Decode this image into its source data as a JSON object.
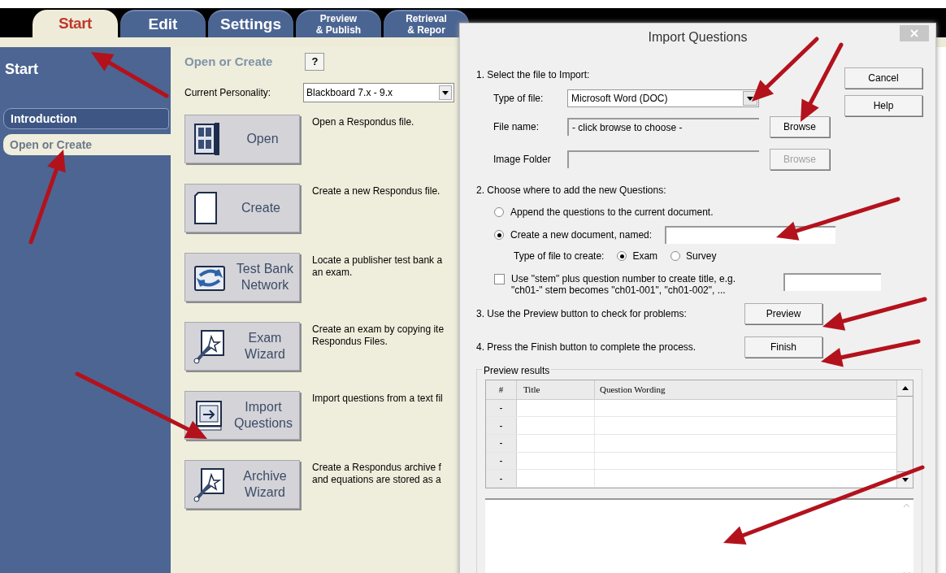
{
  "tabs": [
    {
      "lines": [
        "Start"
      ],
      "selected": true
    },
    {
      "lines": [
        "Edit"
      ],
      "selected": false
    },
    {
      "lines": [
        "Settings"
      ],
      "selected": false
    },
    {
      "lines": [
        "Preview",
        "& Publish"
      ],
      "selected": false
    },
    {
      "lines": [
        "Retrieval",
        "& Repor"
      ],
      "selected": false
    }
  ],
  "sidebar": {
    "title": "Start",
    "items": [
      {
        "label": "Introduction",
        "selected": false
      },
      {
        "label": "Open or Create",
        "selected": true
      }
    ]
  },
  "main": {
    "heading": "Open or Create",
    "help": "?",
    "personality_label": "Current Personality:",
    "personality_value": "Blackboard 7.x - 9.x",
    "actions": [
      {
        "kind": "open",
        "lines": [
          "Open"
        ],
        "description": [
          "Open a Respondus file."
        ]
      },
      {
        "kind": "create",
        "lines": [
          "Create"
        ],
        "description": [
          "Create a new Respondus file."
        ]
      },
      {
        "kind": "network",
        "lines": [
          "Test Bank",
          "Network"
        ],
        "description": [
          "Locate a publisher test bank a",
          "an exam."
        ]
      },
      {
        "kind": "wizard",
        "lines": [
          "Exam",
          "Wizard"
        ],
        "description": [
          "Create an exam by copying ite",
          "Respondus Files."
        ]
      },
      {
        "kind": "import",
        "lines": [
          "Import",
          "Questions"
        ],
        "description": [
          "Import questions from a text fil"
        ]
      },
      {
        "kind": "wizard",
        "lines": [
          "Archive",
          "Wizard"
        ],
        "description": [
          "Create a Respondus archive f",
          "and equations are stored as a"
        ]
      }
    ]
  },
  "dialog": {
    "title": "Import Questions",
    "cancel": "Cancel",
    "help": "Help",
    "step1": "1.  Select the file to Import:",
    "type_label": "Type of file:",
    "type_value": "Microsoft Word (DOC)",
    "file_label": "File name:",
    "file_value": "- click browse to choose -",
    "browse": "Browse",
    "folder_label": "Image Folder",
    "folder_browse": "Browse",
    "folder_browse_disabled": true,
    "step2": "2.  Choose where to add the new Questions:",
    "targets": [
      {
        "label": "Append the questions to the current document.",
        "selected": false
      },
      {
        "label": "Create a new document, named:",
        "selected": true
      }
    ],
    "filetype_label": "Type of file to create:",
    "filetypes": [
      {
        "label": "Exam",
        "selected": true
      },
      {
        "label": "Survey",
        "selected": false
      }
    ],
    "stem_checked": false,
    "stem_lines": [
      "Use \"stem\" plus question number to create title,  e.g.",
      "\"ch01-\" stem becomes \"ch01-001\",  \"ch01-002\",  ..."
    ],
    "step3": "3.  Use the Preview button to check for problems:",
    "preview": "Preview",
    "step4": "4.  Press the Finish button to complete the process.",
    "finish": "Finish",
    "results_label": "Preview results",
    "table": {
      "columns": [
        "#",
        "Title",
        "Question Wording"
      ],
      "rows": [
        [
          "-"
        ],
        [
          "-"
        ],
        [
          "-"
        ],
        [
          "-"
        ],
        [
          "-"
        ]
      ]
    }
  }
}
